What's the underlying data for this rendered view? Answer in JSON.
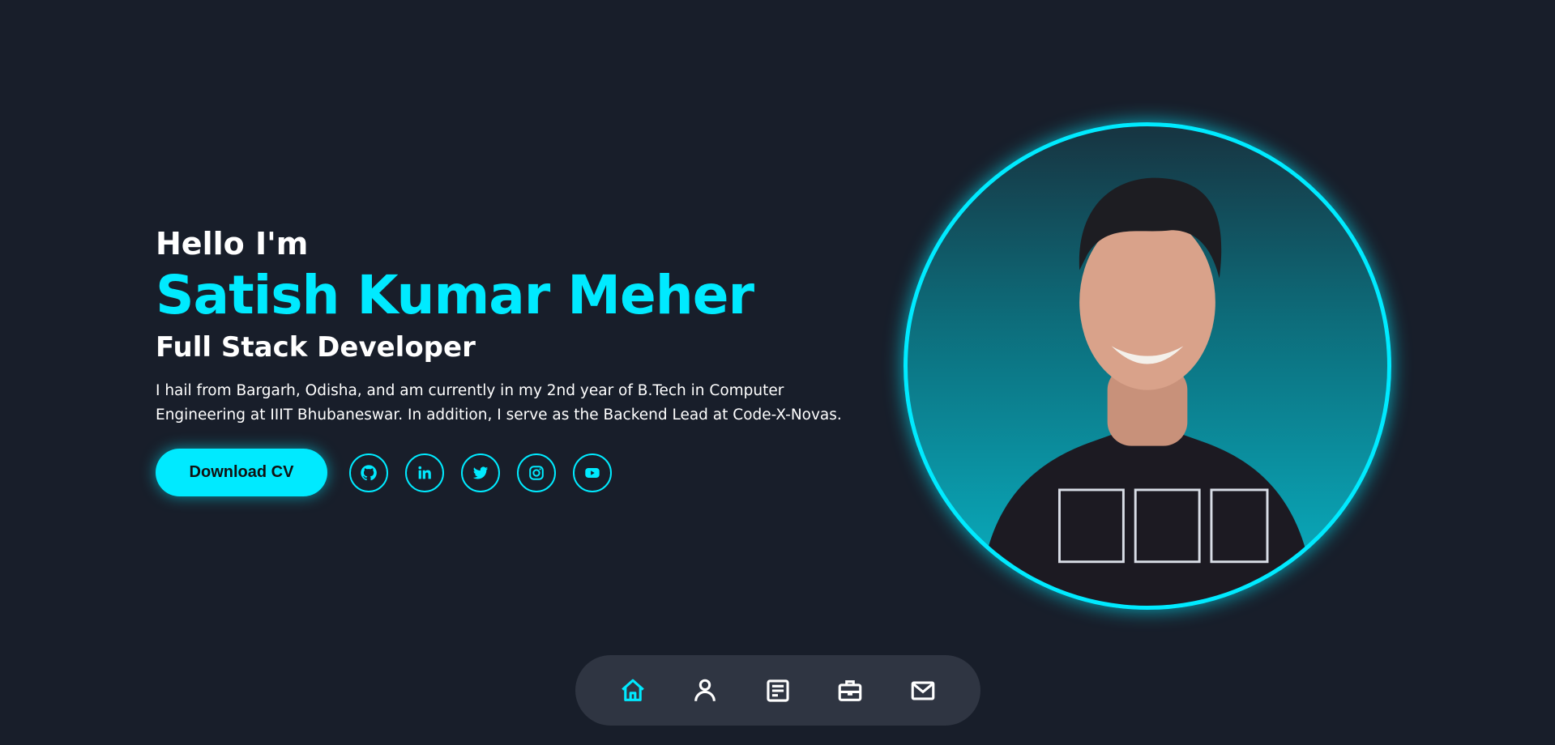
{
  "hero": {
    "greeting": "Hello I'm",
    "name": "Satish Kumar Meher",
    "role": "Full Stack Developer",
    "bio": "I hail from Bargarh, Odisha, and am currently in my 2nd year of B.Tech in Computer Engineering at IIIT Bhubaneswar. In addition, I serve as the Backend Lead at Code-X-Novas.",
    "cv_button": "Download CV",
    "socials": [
      "github-icon",
      "linkedin-icon",
      "twitter-icon",
      "instagram-icon",
      "youtube-icon"
    ]
  },
  "photo": {
    "alt": "Satish Kumar Meher"
  },
  "nav": {
    "items": [
      {
        "icon": "home-icon",
        "active": true
      },
      {
        "icon": "user-icon",
        "active": false
      },
      {
        "icon": "resume-icon",
        "active": false
      },
      {
        "icon": "briefcase-icon",
        "active": false
      },
      {
        "icon": "mail-icon",
        "active": false
      }
    ]
  },
  "colors": {
    "accent": "#00eaff",
    "background": "#181e2a",
    "nav_background": "#2f3542"
  }
}
